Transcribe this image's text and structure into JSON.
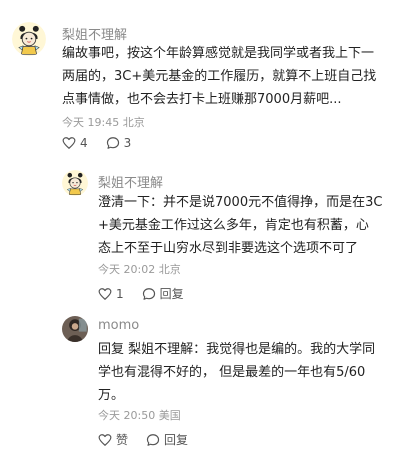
{
  "comments": [
    {
      "author": "梨姐不理解",
      "avatar_icon": "girl-avatar-icon",
      "lines": [
        "编故事吧，按这个年龄算感觉就是我同学或者我上下一",
        "两届的，3C+美元基金的工作履历，就算不上班自己找",
        "点事情做，也不会去打卡上班赚那7000月薪吧..."
      ],
      "time": "今天 19:45",
      "location": "北京",
      "likes": "4",
      "replies": "3"
    },
    {
      "author": "梨姐不理解",
      "avatar_icon": "girl-avatar-icon",
      "lines": [
        "澄清一下：并不是说7000元不值得挣，而是在3C",
        "+美元基金工作过这么多年，肯定也有积蓄，心",
        "态上不至于山穷水尽到非要选这个选项不可了"
      ],
      "time": "今天 20:02",
      "location": "北京",
      "likes": "1",
      "reply_label": "回复"
    },
    {
      "author": "momo",
      "avatar_icon": "photo-avatar-icon",
      "lines": [
        "回复 梨姐不理解：我觉得也是编的。我的大学同",
        "学也有混得不好的， 但是最差的一年也有5/60",
        "万。"
      ],
      "time": "今天 20:50",
      "location": "美国",
      "like_label": "赞",
      "reply_label": "回复"
    }
  ],
  "colors": {
    "text": "#222222",
    "meta": "#9a9a9a",
    "name": "#8a8a8a"
  }
}
